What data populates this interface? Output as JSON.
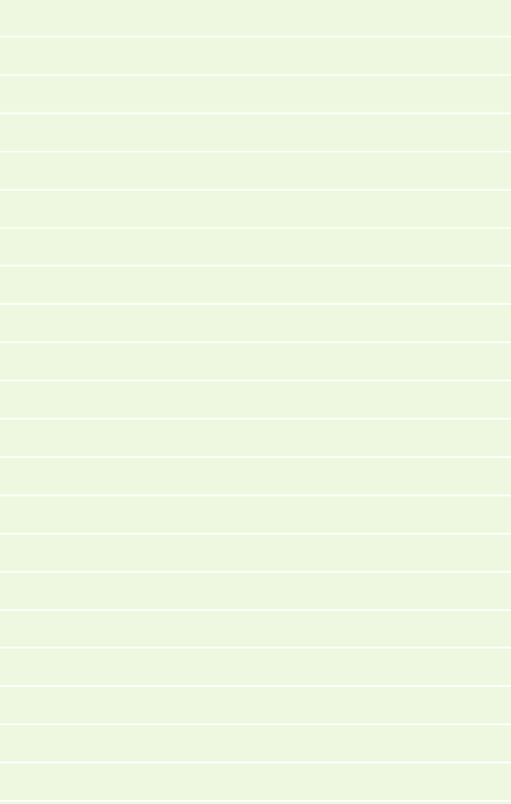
{
  "page": {
    "background_color": "#eef8e0",
    "line_color": "#ffffff"
  },
  "lined_area": {
    "line_count": 21
  }
}
